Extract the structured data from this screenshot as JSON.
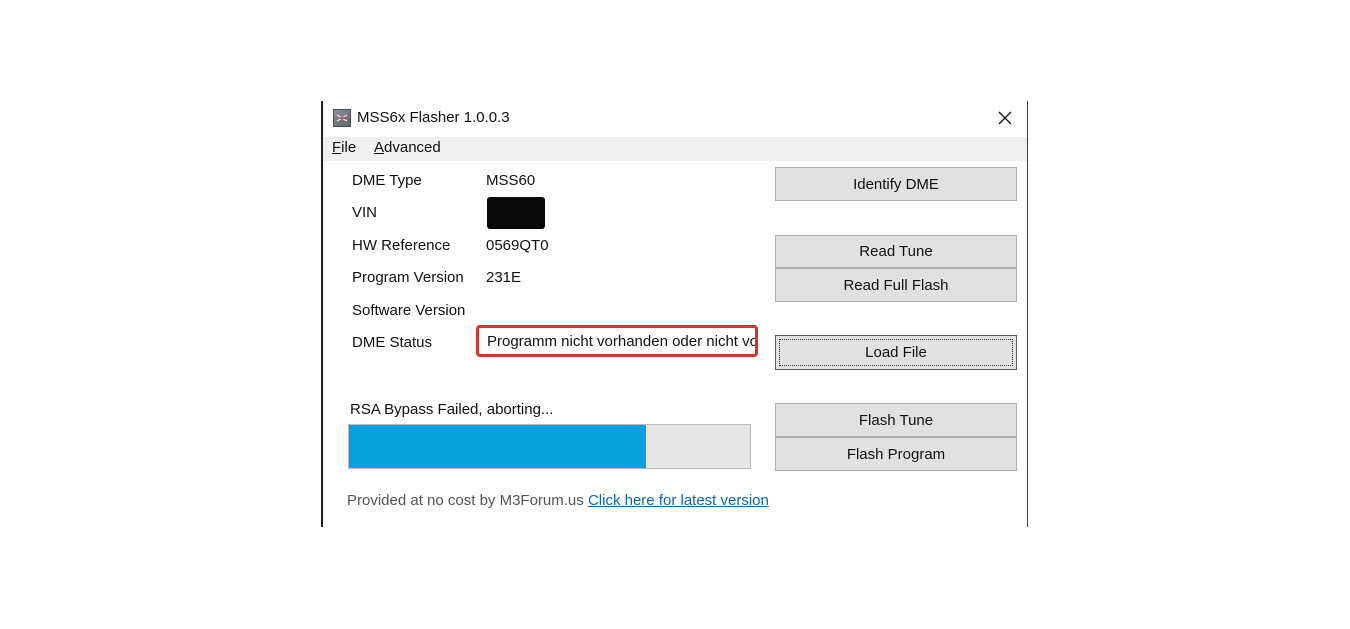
{
  "window": {
    "title": "MSS6x Flasher 1.0.0.3",
    "icon": "app-icon",
    "close_icon": "close-icon"
  },
  "menu": {
    "file_accel": "F",
    "file_rest": "ile",
    "advanced_accel": "A",
    "advanced_rest": "dvanced"
  },
  "info": {
    "dme_type_label": "DME Type",
    "dme_type_value": "MSS60",
    "vin_label": "VIN",
    "hw_reference_label": "HW Reference",
    "hw_reference_value": "0569QT0",
    "program_version_label": "Program Version",
    "program_version_value": "231E",
    "software_version_label": "Software Version",
    "dme_status_label": "DME Status",
    "dme_status_value": "Programm nicht vorhanden oder nicht vollständig"
  },
  "buttons": {
    "identify_dme": "Identify DME",
    "read_tune": "Read Tune",
    "read_full_flash": "Read Full Flash",
    "load_file": "Load File",
    "flash_tune": "Flash Tune",
    "flash_program": "Flash Program"
  },
  "progress": {
    "status_text": "RSA Bypass Failed, aborting...",
    "percent": 74,
    "fill_color": "#06a0dc"
  },
  "footer": {
    "text": "Provided at no cost by M3Forum.us",
    "link_text": "Click here for latest version"
  },
  "colors": {
    "status_highlight": "#d9342b",
    "link": "#0c67b8"
  }
}
